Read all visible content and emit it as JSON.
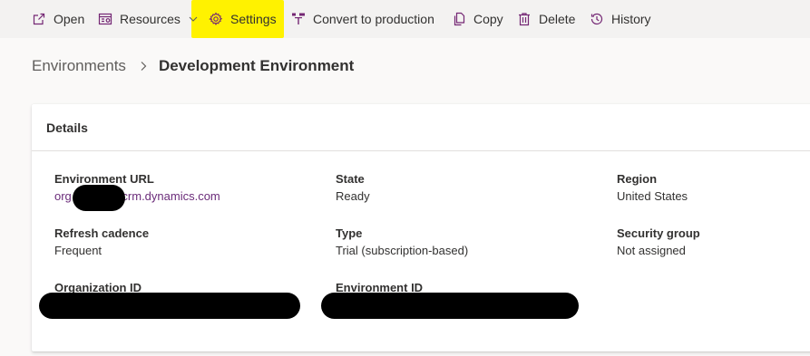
{
  "toolbar": {
    "open_label": "Open",
    "resources_label": "Resources",
    "settings_label": "Settings",
    "convert_label": "Convert to production",
    "copy_label": "Copy",
    "delete_label": "Delete",
    "history_label": "History",
    "highlight_color": "#fff200",
    "icon_color": "#742774"
  },
  "breadcrumb": {
    "root": "Environments",
    "current": "Development Environment"
  },
  "details": {
    "title": "Details",
    "environment_url": {
      "label": "Environment URL",
      "value_prefix": "org",
      "value_suffix": ".crm.dynamics.com"
    },
    "state": {
      "label": "State",
      "value": "Ready"
    },
    "region": {
      "label": "Region",
      "value": "United States"
    },
    "refresh_cadence": {
      "label": "Refresh cadence",
      "value": "Frequent"
    },
    "type": {
      "label": "Type",
      "value": "Trial (subscription-based)"
    },
    "security_group": {
      "label": "Security group",
      "value": "Not assigned"
    },
    "organization_id": {
      "label": "Organization ID"
    },
    "environment_id": {
      "label": "Environment ID"
    }
  }
}
